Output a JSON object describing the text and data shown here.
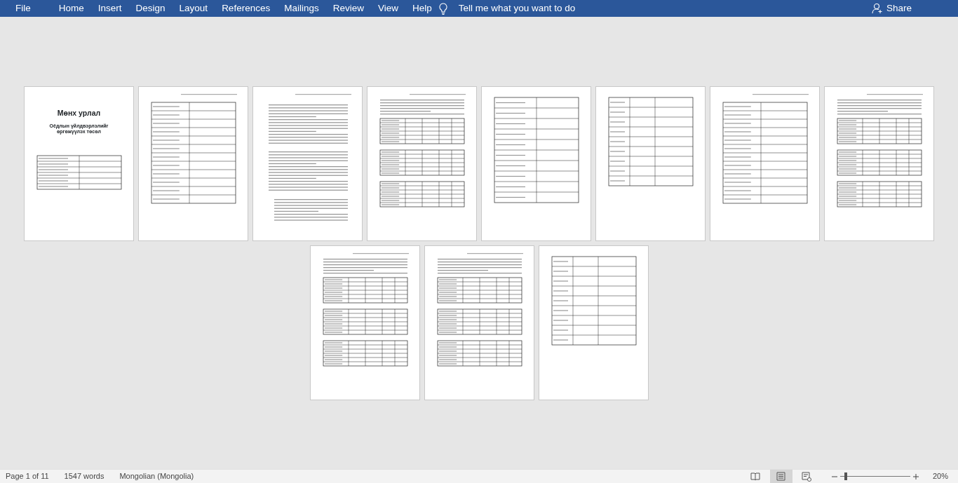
{
  "menu": [
    {
      "label": "File"
    },
    {
      "label": "Home"
    },
    {
      "label": "Insert"
    },
    {
      "label": "Design"
    },
    {
      "label": "Layout"
    },
    {
      "label": "References"
    },
    {
      "label": "Mailings"
    },
    {
      "label": "Review"
    },
    {
      "label": "View"
    },
    {
      "label": "Help"
    }
  ],
  "tell_me": {
    "placeholder": "Tell me what you want to do"
  },
  "share": "Share",
  "pages": [
    {
      "kind": "cover",
      "title": "Мөнх урлал",
      "subtitle": "Оёдлын үйлдвэрлэлийг өргөжүүлэх төсөл"
    },
    {
      "kind": "form"
    },
    {
      "kind": "text"
    },
    {
      "kind": "tables"
    },
    {
      "kind": "columns"
    },
    {
      "kind": "grid"
    },
    {
      "kind": "form"
    },
    {
      "kind": "tables"
    },
    {
      "kind": "tables"
    },
    {
      "kind": "tables"
    },
    {
      "kind": "grid"
    }
  ],
  "status_bar": {
    "page": "Page 1 of 11",
    "words": "1547 words",
    "language": "Mongolian (Mongolia)",
    "views": [
      {
        "kind": "read",
        "selected": false
      },
      {
        "kind": "print",
        "selected": true
      },
      {
        "kind": "web",
        "selected": false
      }
    ],
    "zoom": {
      "level": 0.08,
      "reading": "20%"
    }
  }
}
